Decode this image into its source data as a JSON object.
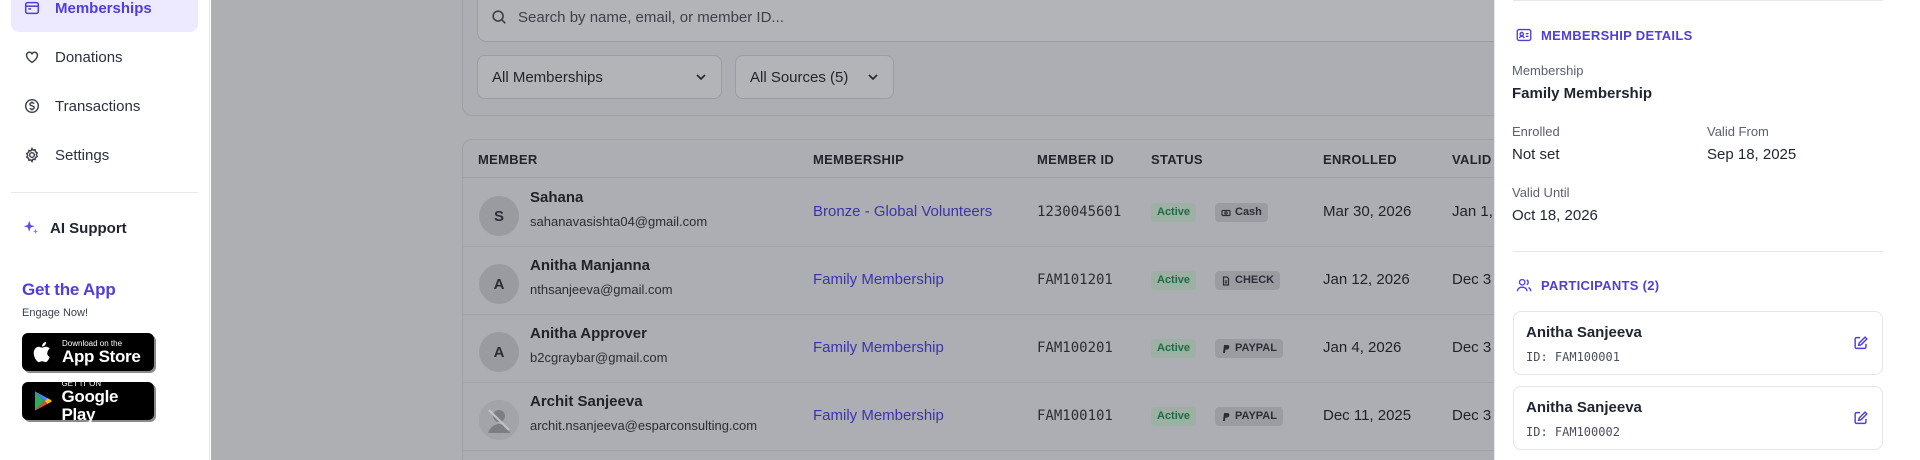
{
  "sidebar": {
    "items": [
      {
        "label": "Memberships",
        "icon": "calendar-card-icon",
        "active": true
      },
      {
        "label": "Donations",
        "icon": "heart-icon",
        "active": false
      },
      {
        "label": "Transactions",
        "icon": "dollar-circle-icon",
        "active": false
      },
      {
        "label": "Settings",
        "icon": "gear-icon",
        "active": false
      }
    ],
    "ai_support": "AI Support",
    "get_app_title": "Get the App",
    "get_app_sub": "Engage Now!",
    "app_store": {
      "small": "Download on the",
      "big": "App Store"
    },
    "google_play": {
      "small": "GET IT ON",
      "big": "Google Play"
    }
  },
  "main": {
    "search_placeholder": "Search by name, email, or member ID...",
    "filter_memberships": "All Memberships",
    "filter_sources": "All Sources (5)",
    "columns": {
      "member": "MEMBER",
      "membership": "MEMBERSHIP",
      "member_id": "MEMBER ID",
      "status": "STATUS",
      "enrolled": "ENROLLED",
      "valid": "VALID"
    },
    "rows": [
      {
        "initial": "S",
        "name": "Sahana",
        "email": "sahanavasishta04@gmail.com",
        "membership": "Bronze - Global Volunteers",
        "member_id": "1230045601",
        "status": "Active",
        "source": "Cash",
        "enrolled": "Mar 30, 2026",
        "valid": "Jan 1,"
      },
      {
        "initial": "A",
        "name": "Anitha Manjanna",
        "email": "nthsanjeeva@gmail.com",
        "membership": "Family Membership",
        "member_id": "FAM101201",
        "status": "Active",
        "source": "CHECK",
        "enrolled": "Jan 12, 2026",
        "valid": "Dec 3"
      },
      {
        "initial": "A",
        "name": "Anitha Approver",
        "email": "b2cgraybar@gmail.com",
        "membership": "Family Membership",
        "member_id": "FAM100201",
        "status": "Active",
        "source": "PAYPAL",
        "enrolled": "Jan 4, 2026",
        "valid": "Dec 3"
      },
      {
        "initial": "",
        "name": "Archit Sanjeeva",
        "email": "archit.nsanjeeva@esparconsulting.com",
        "membership": "Family Membership",
        "member_id": "FAM100101",
        "status": "Active",
        "source": "PAYPAL",
        "enrolled": "Dec 11, 2025",
        "valid": "Dec 3"
      }
    ]
  },
  "panel": {
    "details_title": "MEMBERSHIP DETAILS",
    "membership_label": "Membership",
    "membership_value": "Family Membership",
    "enrolled_label": "Enrolled",
    "enrolled_value": "Not set",
    "valid_from_label": "Valid From",
    "valid_from_value": "Sep 18, 2025",
    "valid_until_label": "Valid Until",
    "valid_until_value": "Oct 18, 2026",
    "participants_title": "PARTICIPANTS (2)",
    "participants": [
      {
        "name": "Anitha Sanjeeva",
        "id": "ID: FAM100001"
      },
      {
        "name": "Anitha Sanjeeva",
        "id": "ID: FAM100002"
      }
    ]
  },
  "colors": {
    "accent": "#4f3fd8",
    "active_nav_bg": "#ede9fe",
    "overlay": "#aeafb3"
  }
}
